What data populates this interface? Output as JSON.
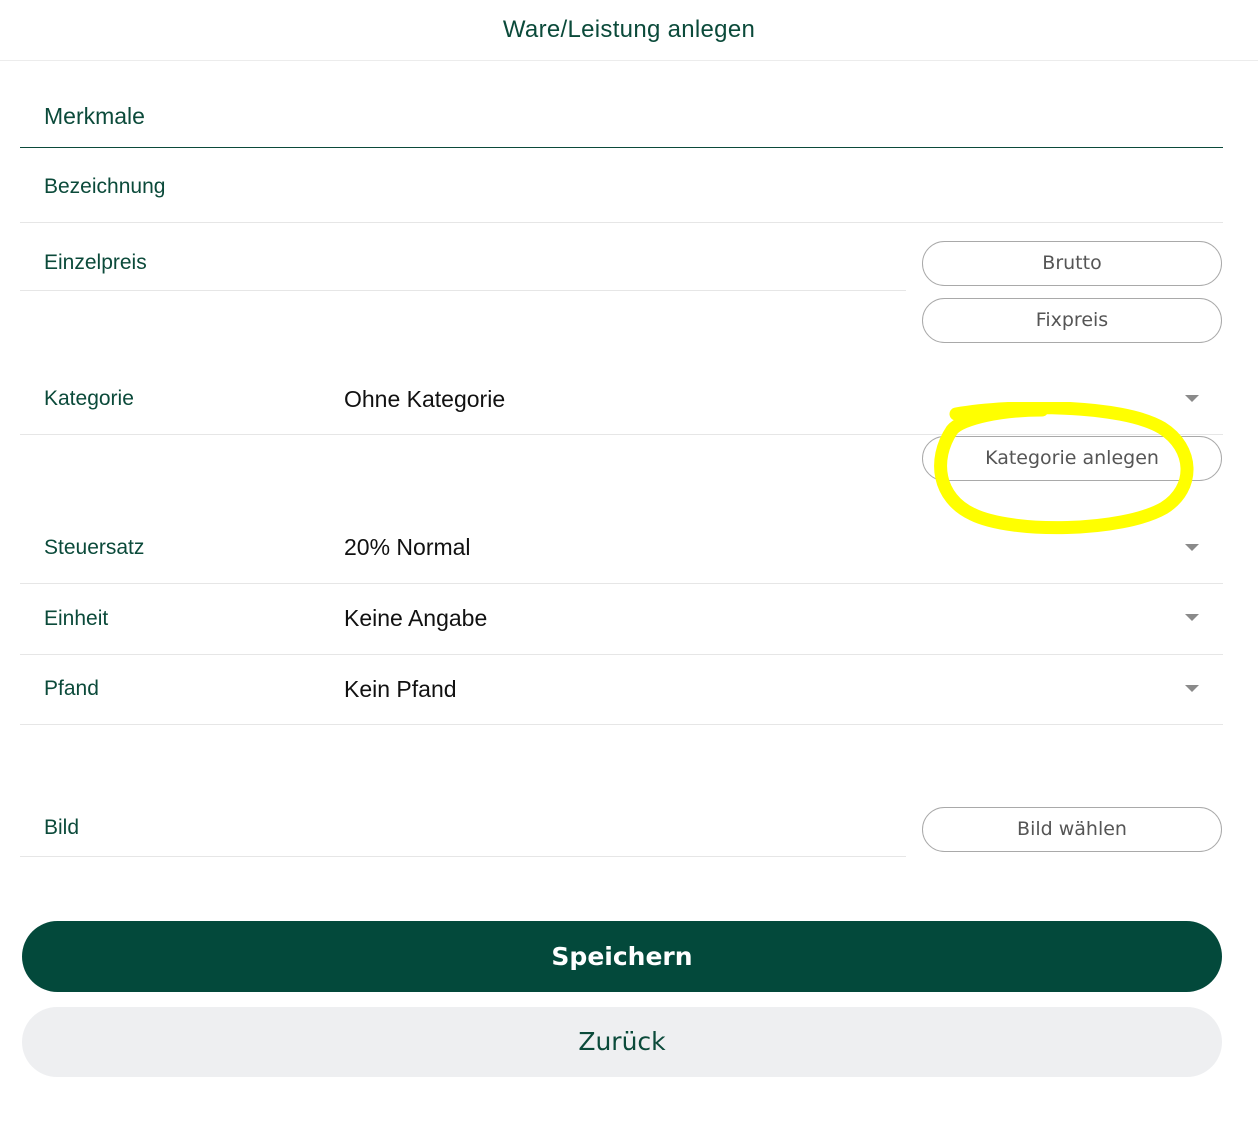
{
  "header": {
    "title": "Ware/Leistung anlegen"
  },
  "section": {
    "title": "Merkmale"
  },
  "fields": {
    "bezeichnung": {
      "label": "Bezeichnung",
      "value": ""
    },
    "einzelpreis": {
      "label": "Einzelpreis",
      "value": ""
    },
    "kategorie": {
      "label": "Kategorie",
      "value": "Ohne Kategorie"
    },
    "steuersatz": {
      "label": "Steuersatz",
      "value": "20% Normal"
    },
    "einheit": {
      "label": "Einheit",
      "value": "Keine Angabe"
    },
    "pfand": {
      "label": "Pfand",
      "value": "Kein Pfand"
    },
    "bild": {
      "label": "Bild"
    }
  },
  "buttons": {
    "brutto": "Brutto",
    "fixpreis": "Fixpreis",
    "kategorie_anlegen": "Kategorie anlegen",
    "bild_waehlen": "Bild wählen",
    "speichern": "Speichern",
    "zurueck": "Zurück"
  },
  "icons": {
    "dropdown": "chevron-down-icon"
  },
  "colors": {
    "brand": "#03493b",
    "text_green": "#0b4a3a",
    "secondary_bg": "#eeeff1",
    "highlight": "#ffff00"
  }
}
